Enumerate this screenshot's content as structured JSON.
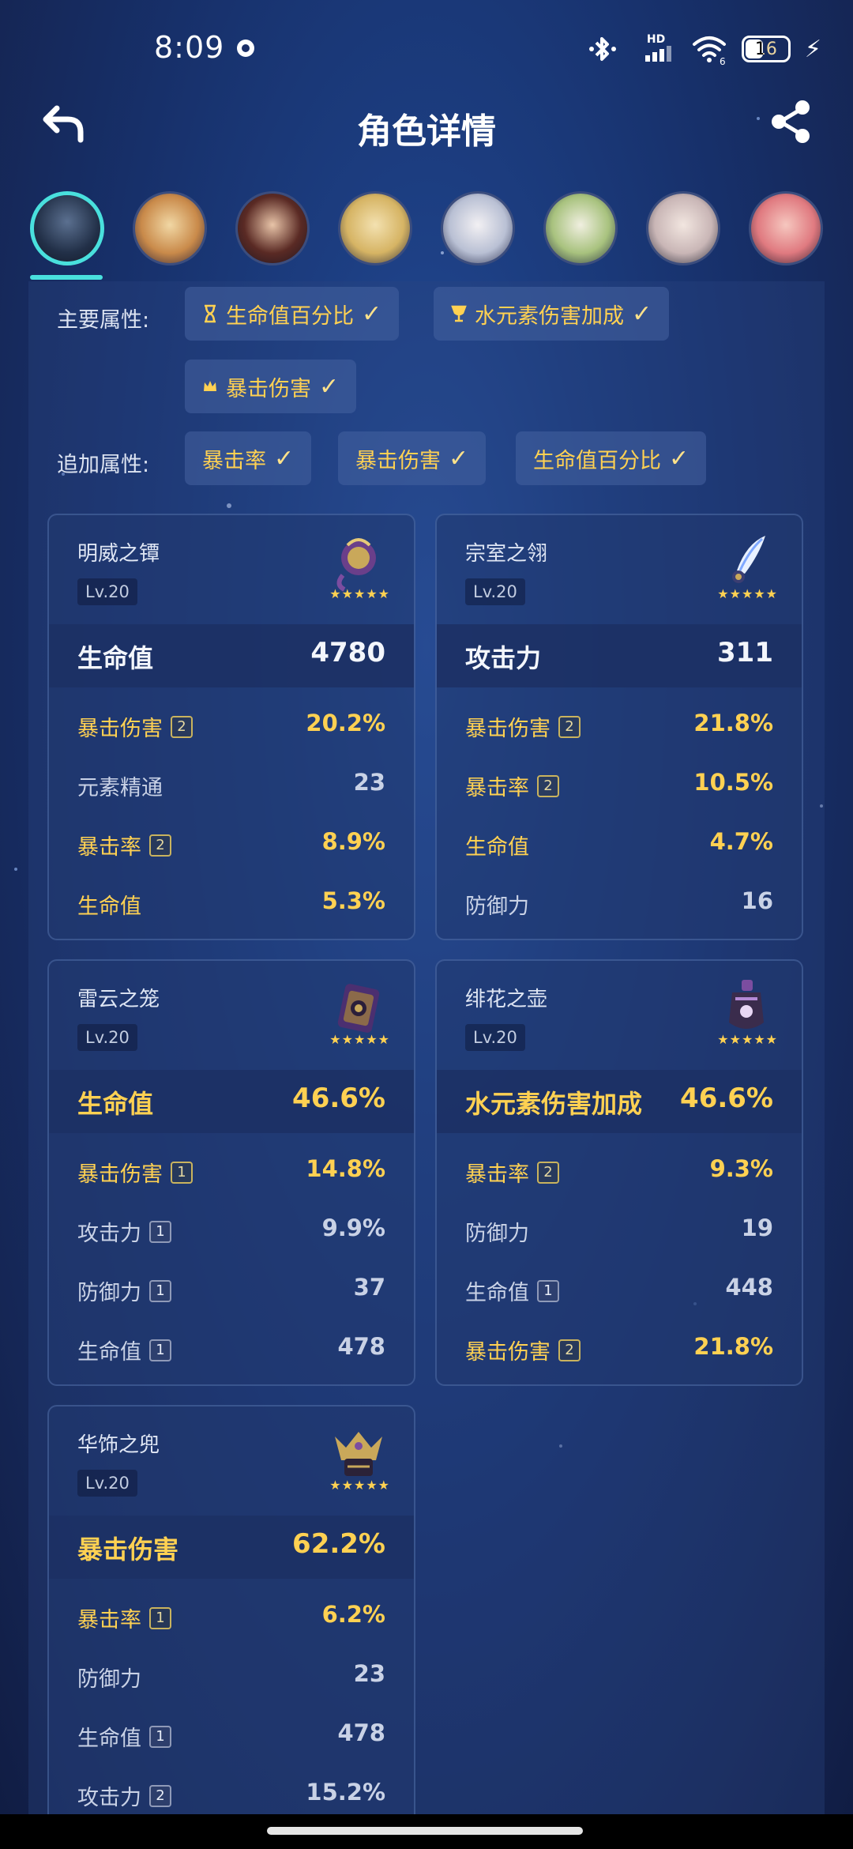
{
  "status": {
    "time": "8:09",
    "network": "HD",
    "wifi_badge": "6",
    "battery": "16"
  },
  "header": {
    "title": "角色详情"
  },
  "main_attrs": {
    "label": "主要属性:",
    "items": [
      {
        "text": "生命值百分比",
        "icon": "hourglass-icon"
      },
      {
        "text": "水元素伤害加成",
        "icon": "goblet-icon"
      },
      {
        "text": "暴击伤害",
        "icon": "crown-icon"
      }
    ]
  },
  "extra_attrs": {
    "label": "追加属性:",
    "items": [
      {
        "text": "暴击率"
      },
      {
        "text": "暴击伤害"
      },
      {
        "text": "生命值百分比"
      }
    ]
  },
  "check": "✓",
  "stars": "★★★★★",
  "artifacts": [
    {
      "name": "明威之镡",
      "level": "Lv.20",
      "icon": "flower-artifact-icon",
      "main": {
        "label": "生命值",
        "value": "4780",
        "highlight": false
      },
      "subs": [
        {
          "label": "暴击伤害",
          "badge": "2",
          "value": "20.2%",
          "highlight": true
        },
        {
          "label": "元素精通",
          "badge": "",
          "value": "23",
          "highlight": false
        },
        {
          "label": "暴击率",
          "badge": "2",
          "value": "8.9%",
          "highlight": true
        },
        {
          "label": "生命值",
          "badge": "",
          "value": "5.3%",
          "highlight": true
        }
      ]
    },
    {
      "name": "宗室之翎",
      "level": "Lv.20",
      "icon": "plume-artifact-icon",
      "main": {
        "label": "攻击力",
        "value": "311",
        "highlight": false
      },
      "subs": [
        {
          "label": "暴击伤害",
          "badge": "2",
          "value": "21.8%",
          "highlight": true
        },
        {
          "label": "暴击率",
          "badge": "2",
          "value": "10.5%",
          "highlight": true
        },
        {
          "label": "生命值",
          "badge": "",
          "value": "4.7%",
          "highlight": true
        },
        {
          "label": "防御力",
          "badge": "",
          "value": "16",
          "highlight": false
        }
      ]
    },
    {
      "name": "雷云之笼",
      "level": "Lv.20",
      "icon": "sands-artifact-icon",
      "main": {
        "label": "生命值",
        "value": "46.6%",
        "highlight": true
      },
      "subs": [
        {
          "label": "暴击伤害",
          "badge": "1",
          "value": "14.8%",
          "highlight": true
        },
        {
          "label": "攻击力",
          "badge": "1",
          "value": "9.9%",
          "highlight": false
        },
        {
          "label": "防御力",
          "badge": "1",
          "value": "37",
          "highlight": false
        },
        {
          "label": "生命值",
          "badge": "1",
          "value": "478",
          "highlight": false
        }
      ]
    },
    {
      "name": "绯花之壶",
      "level": "Lv.20",
      "icon": "goblet-artifact-icon",
      "main": {
        "label": "水元素伤害加成",
        "value": "46.6%",
        "highlight": true
      },
      "subs": [
        {
          "label": "暴击率",
          "badge": "2",
          "value": "9.3%",
          "highlight": true
        },
        {
          "label": "防御力",
          "badge": "",
          "value": "19",
          "highlight": false
        },
        {
          "label": "生命值",
          "badge": "1",
          "value": "448",
          "highlight": false
        },
        {
          "label": "暴击伤害",
          "badge": "2",
          "value": "21.8%",
          "highlight": true
        }
      ]
    },
    {
      "name": "华饰之兜",
      "level": "Lv.20",
      "icon": "circlet-artifact-icon",
      "main": {
        "label": "暴击伤害",
        "value": "62.2%",
        "highlight": true
      },
      "subs": [
        {
          "label": "暴击率",
          "badge": "1",
          "value": "6.2%",
          "highlight": true
        },
        {
          "label": "防御力",
          "badge": "",
          "value": "23",
          "highlight": false
        },
        {
          "label": "生命值",
          "badge": "1",
          "value": "478",
          "highlight": false
        },
        {
          "label": "攻击力",
          "badge": "2",
          "value": "15.2%",
          "highlight": false
        }
      ]
    }
  ],
  "colors": {
    "accent": "#49e0dd",
    "gold": "#ffd152"
  }
}
